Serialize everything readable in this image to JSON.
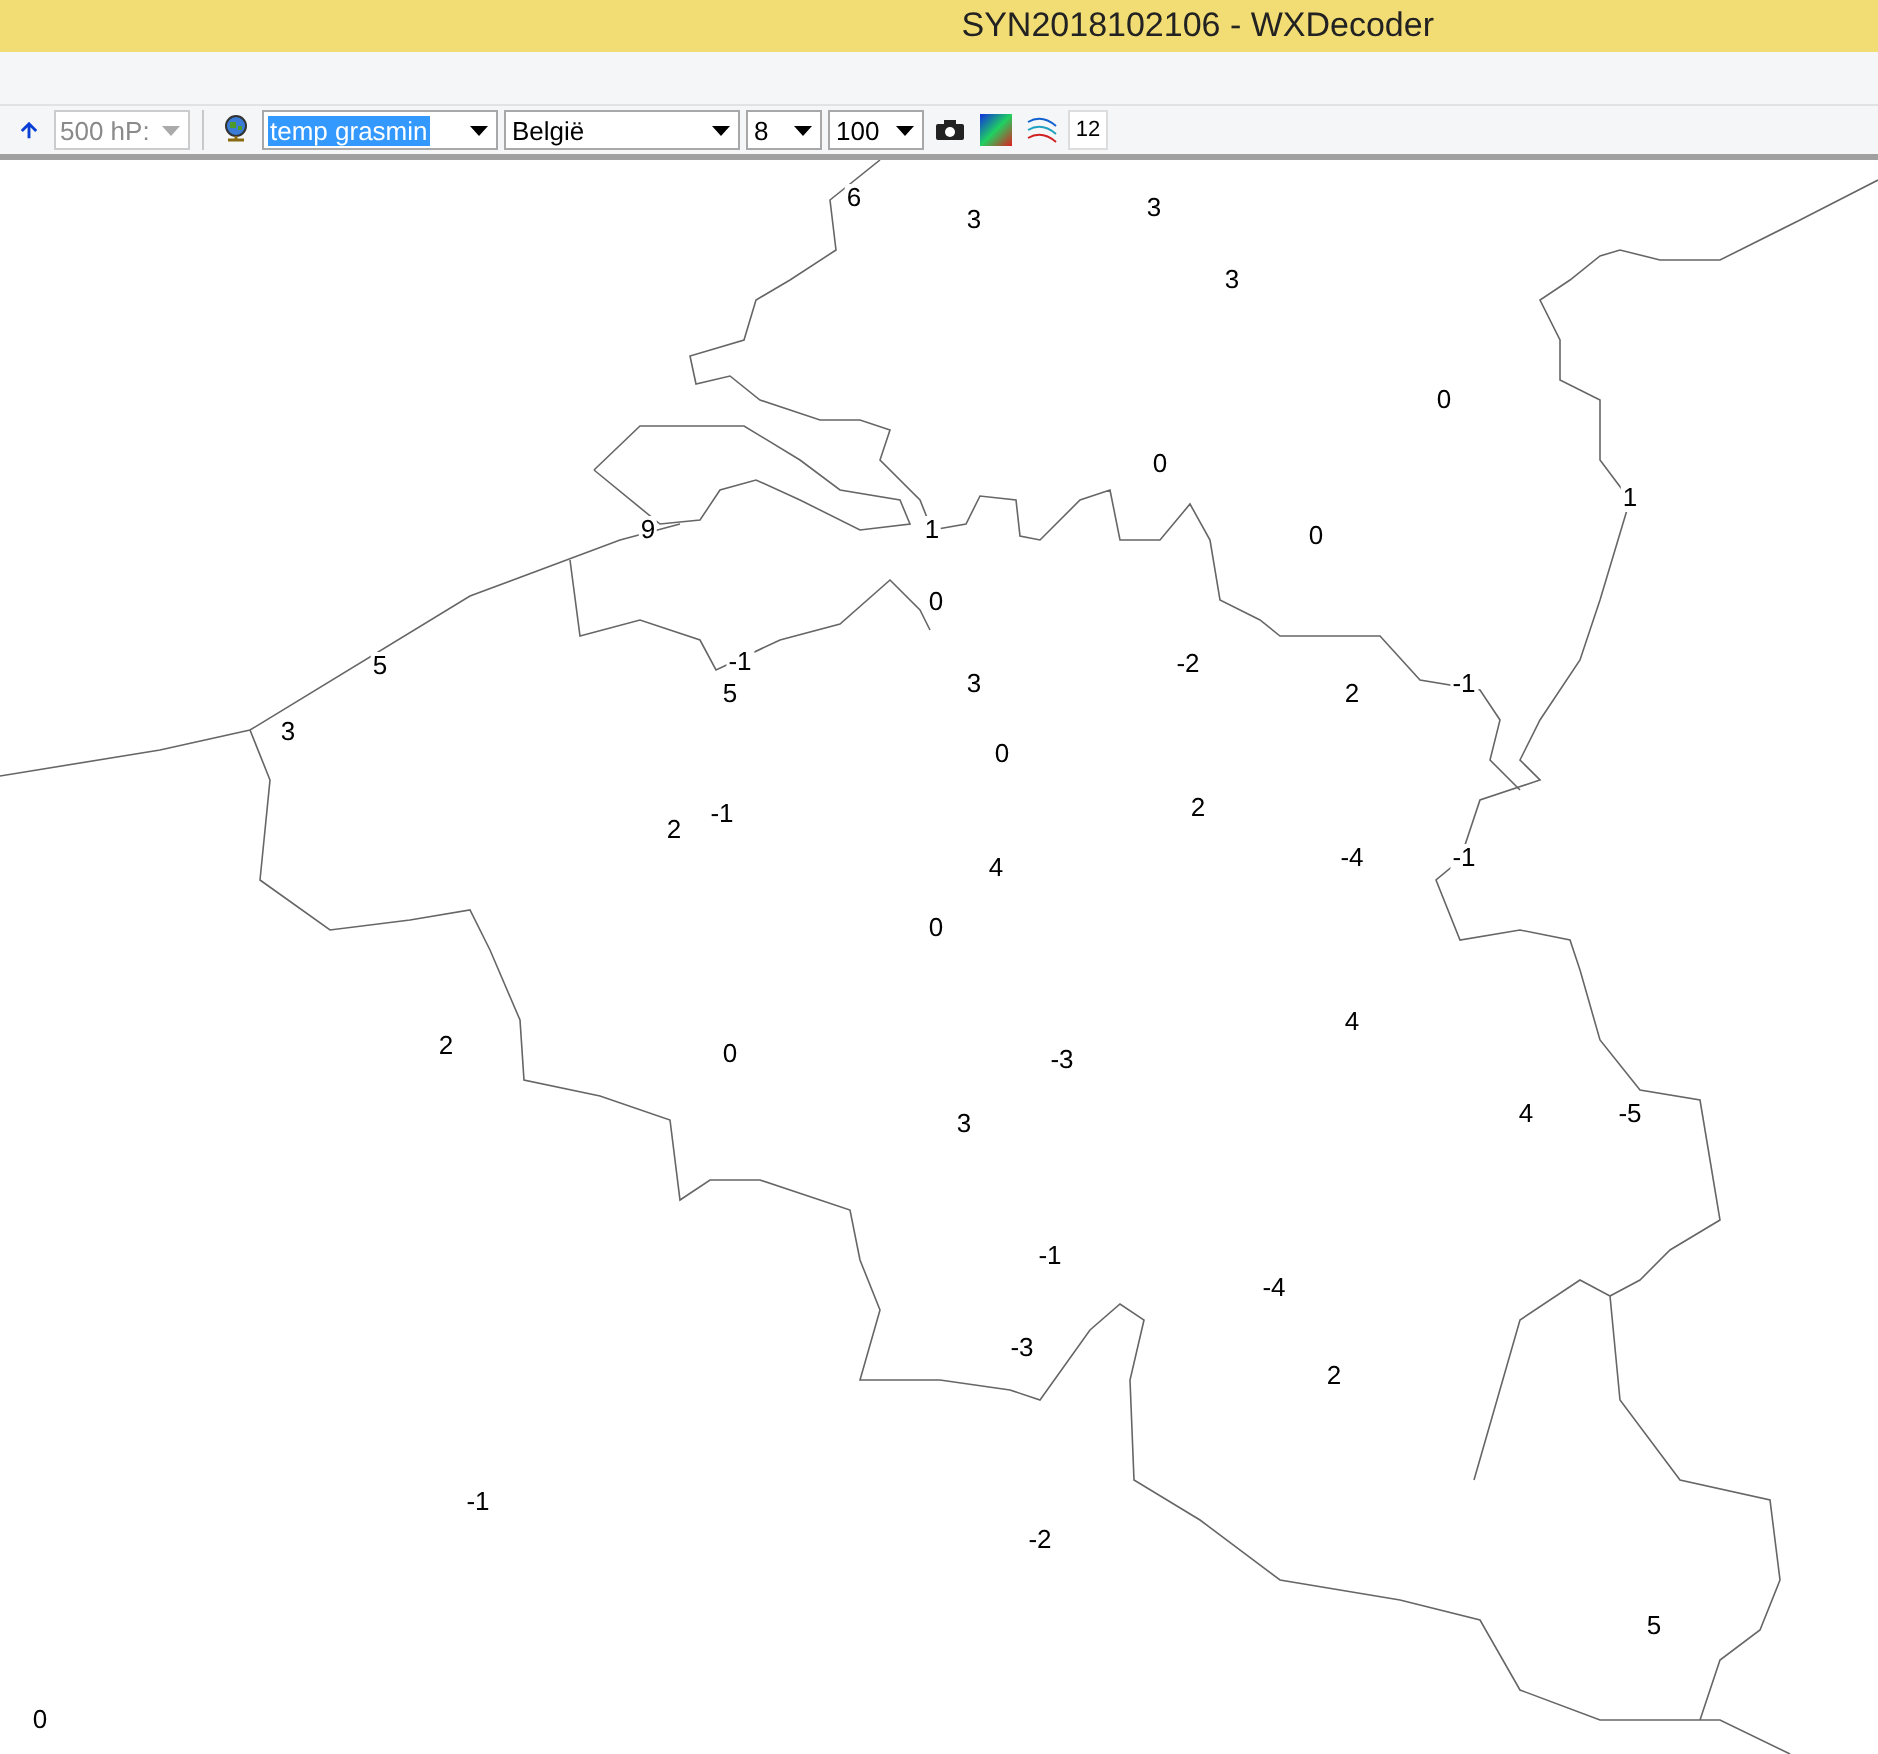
{
  "window": {
    "title": "SYN2018102106 - WXDecoder"
  },
  "toolbar": {
    "level_combo": {
      "value": "500 hP:",
      "disabled": true
    },
    "combos": [
      {
        "value": "temp grasmin",
        "highlighted": true
      },
      {
        "value": "België",
        "highlighted": false
      },
      {
        "value": "8",
        "highlighted": false
      },
      {
        "value": "100",
        "highlighted": false
      }
    ],
    "size_field": {
      "value": "12"
    }
  },
  "map": {
    "stations": [
      {
        "value": "6"
      },
      {
        "value": "3"
      },
      {
        "value": "3"
      },
      {
        "value": "3"
      },
      {
        "value": "0"
      },
      {
        "value": "0"
      },
      {
        "value": "1"
      },
      {
        "value": "9"
      },
      {
        "value": "1"
      },
      {
        "value": "0"
      },
      {
        "value": "0"
      },
      {
        "value": "5"
      },
      {
        "value": "-1"
      },
      {
        "value": "5"
      },
      {
        "value": "3"
      },
      {
        "value": "-2"
      },
      {
        "value": "2"
      },
      {
        "value": "-1"
      },
      {
        "value": "3"
      },
      {
        "value": "0"
      },
      {
        "value": "2"
      },
      {
        "value": "-1"
      },
      {
        "value": "2"
      },
      {
        "value": "4"
      },
      {
        "value": "-4"
      },
      {
        "value": "-1"
      },
      {
        "value": "0"
      },
      {
        "value": "2"
      },
      {
        "value": "0"
      },
      {
        "value": "-3"
      },
      {
        "value": "4"
      },
      {
        "value": "3"
      },
      {
        "value": "4"
      },
      {
        "value": "-5"
      },
      {
        "value": "-1"
      },
      {
        "value": "-4"
      },
      {
        "value": "-3"
      },
      {
        "value": "2"
      },
      {
        "value": "-1"
      },
      {
        "value": "-2"
      },
      {
        "value": "5"
      },
      {
        "value": "0"
      }
    ]
  }
}
